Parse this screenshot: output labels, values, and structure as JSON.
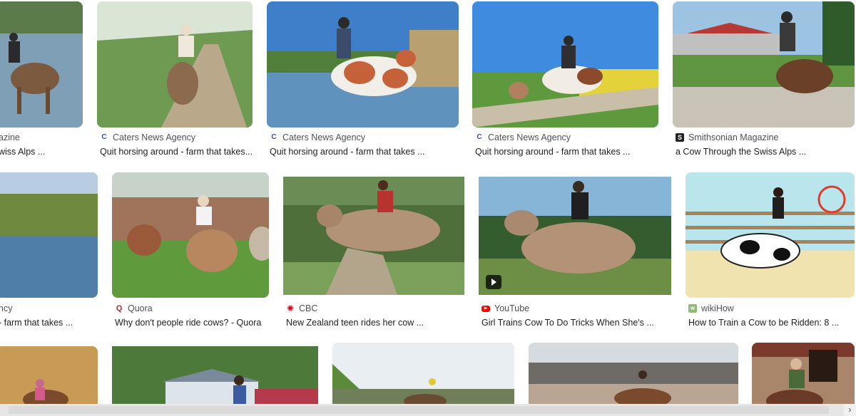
{
  "results": [
    {
      "source": "azine",
      "title": "wiss Alps ...",
      "favicon": "none"
    },
    {
      "source": "Caters News Agency",
      "title": "Quit horsing around - farm that takes...",
      "favicon": "caters-icon"
    },
    {
      "source": "Caters News Agency",
      "title": "Quit horsing around - farm that takes ...",
      "favicon": "caters-icon"
    },
    {
      "source": "Caters News Agency",
      "title": "Quit horsing around - farm that takes ...",
      "favicon": "caters-icon"
    },
    {
      "source": "Smithsonian Magazine",
      "title": "a Cow Through the Swiss Alps ...",
      "favicon": "smithsonian-icon"
    },
    {
      "source": "ncy",
      "title": "- farm that takes ...",
      "favicon": "none"
    },
    {
      "source": "Quora",
      "title": "Why don't people ride cows? - Quora",
      "favicon": "quora-icon"
    },
    {
      "source": "CBC",
      "title": "New Zealand teen rides her cow ...",
      "favicon": "cbc-icon"
    },
    {
      "source": "YouTube",
      "title": "Girl Trains Cow To Do Tricks When She's ...",
      "favicon": "youtube-icon"
    },
    {
      "source": "wikiHow",
      "title": "How to Train a Cow to be Ridden: 8 ...",
      "favicon": "wikihow-icon"
    }
  ],
  "colors": {
    "caters": "#3c4fb0",
    "quora": "#b92b27",
    "cbc": "#d0021b",
    "youtube": "#ff0000",
    "wikihow": "#93b874",
    "smithsonian": "#222222"
  },
  "scrollbar": {
    "right_arrow": "›"
  }
}
